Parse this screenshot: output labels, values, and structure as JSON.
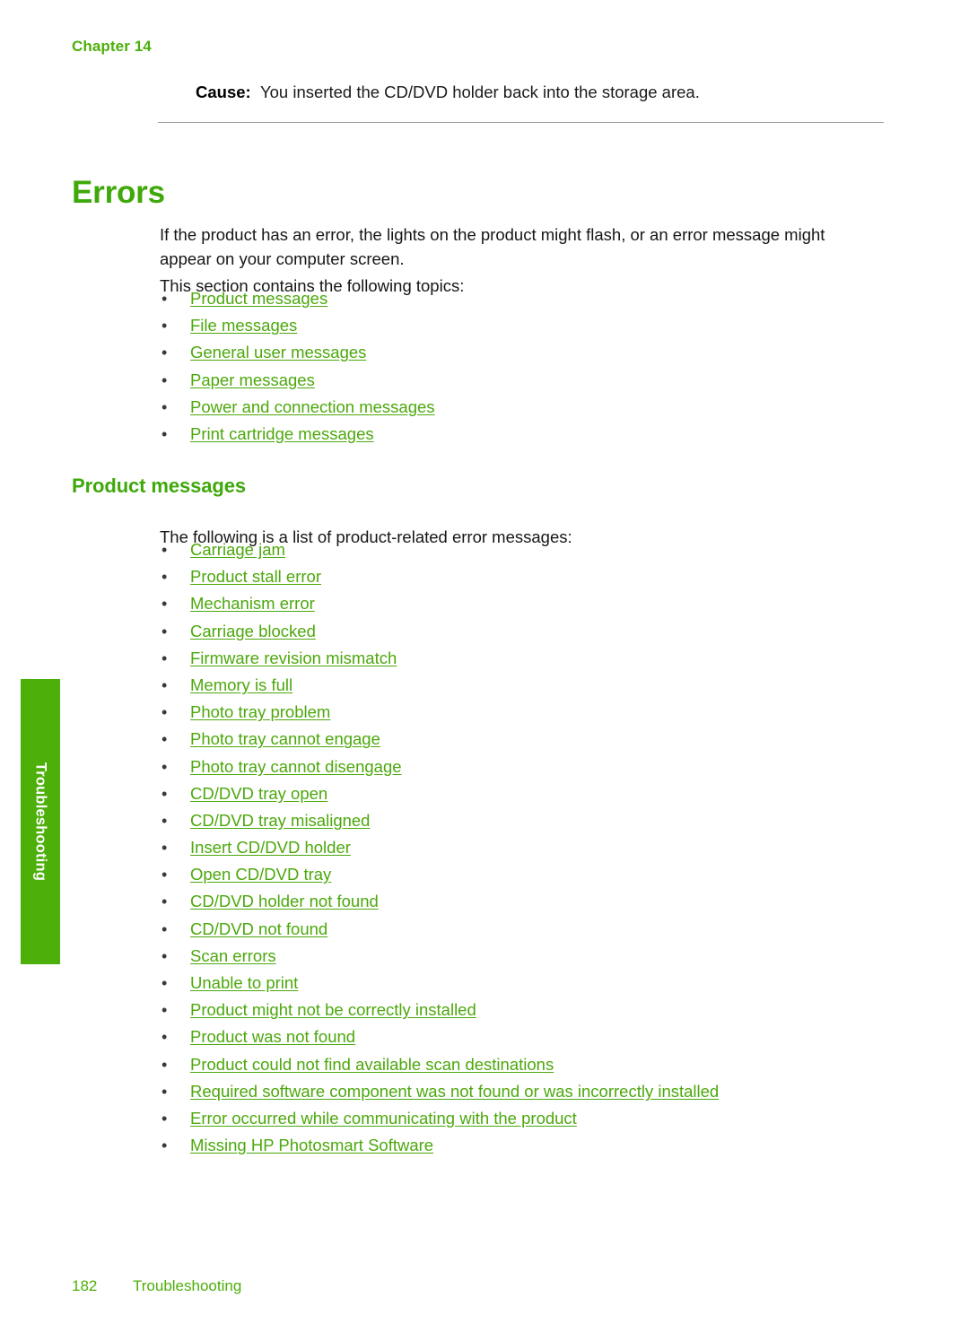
{
  "document": {
    "chapter_header": "Chapter 14",
    "page_number": "182",
    "footer_section": "Troubleshooting",
    "side_tab_label": "Troubleshooting",
    "accent_green": "#4caf0a",
    "heading_green": "#3fa80a",
    "link_green": "#4ca80c",
    "rule_color": "#9a9a9a"
  },
  "cause": {
    "label": "Cause:",
    "text": "You inserted the CD/DVD holder back into the storage area."
  },
  "section": {
    "title": "Errors",
    "intro": "If the product has an error, the lights on the product might flash, or an error message might appear on your computer screen.",
    "topics_lead": "This section contains the following topics:",
    "topics": [
      "Product messages",
      "File messages",
      "General user messages",
      "Paper messages",
      "Power and connection messages",
      "Print cartridge messages"
    ]
  },
  "subsection": {
    "title": "Product messages",
    "lead": "The following is a list of product-related error messages:",
    "links": [
      "Carriage jam",
      "Product stall error",
      "Mechanism error",
      "Carriage blocked",
      "Firmware revision mismatch",
      "Memory is full",
      "Photo tray problem",
      "Photo tray cannot engage",
      "Photo tray cannot disengage",
      "CD/DVD tray open",
      "CD/DVD tray misaligned",
      "Insert CD/DVD holder",
      "Open CD/DVD tray",
      "CD/DVD holder not found",
      "CD/DVD not found",
      "Scan errors",
      "Unable to print",
      "Product might not be correctly installed",
      "Product was not found",
      "Product could not find available scan destinations",
      "Required software component was not found or was incorrectly installed",
      "Error occurred while communicating with the product",
      "Missing HP Photosmart Software"
    ]
  },
  "bullet_glyph": "•"
}
